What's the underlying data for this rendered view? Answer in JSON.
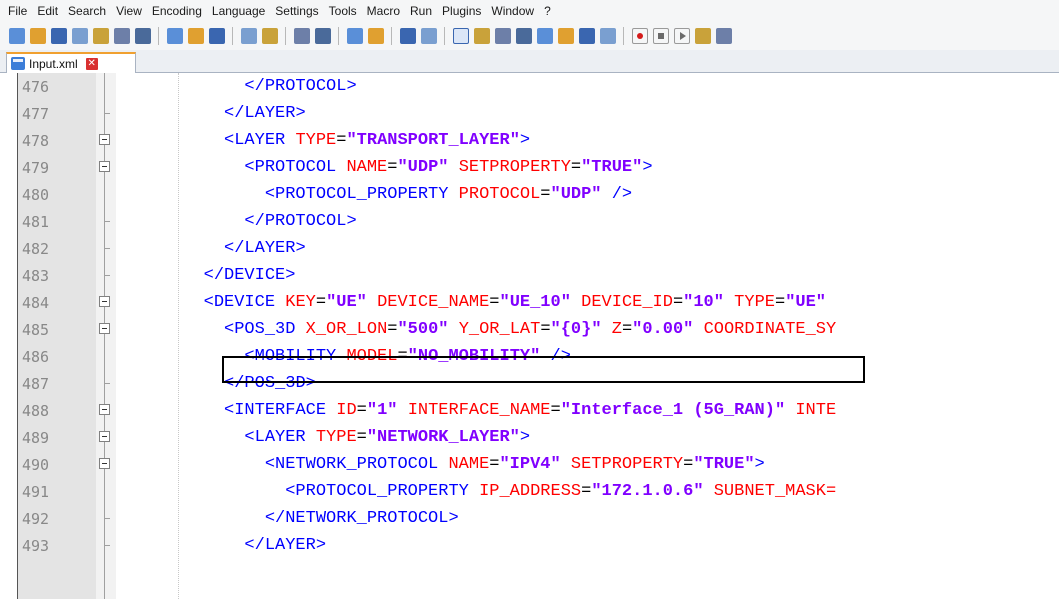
{
  "menu": [
    "File",
    "Edit",
    "Search",
    "View",
    "Encoding",
    "Language",
    "Settings",
    "Tools",
    "Macro",
    "Run",
    "Plugins",
    "Window",
    "?"
  ],
  "tab": {
    "label": "Input.xml",
    "close": "✕"
  },
  "toolbar_icons": [
    "new-file-icon",
    "open-file-icon",
    "save-icon",
    "save-all-icon",
    "close-icon",
    "close-all-icon",
    "print-icon",
    "|",
    "cut-icon",
    "copy-icon",
    "paste-icon",
    "|",
    "undo-icon",
    "redo-icon",
    "|",
    "find-icon",
    "replace-icon",
    "|",
    "zoom-in-icon",
    "zoom-out-icon",
    "|",
    "sync-vertical-icon",
    "sync-horizontal-icon",
    "|",
    "word-wrap-icon",
    "show-all-chars-icon",
    "indent-guide-icon",
    "user-lang-icon",
    "doc-map-icon",
    "function-list-icon",
    "folder-workspace-icon",
    "monitoring-icon",
    "|",
    "record-macro-icon",
    "stop-macro-icon",
    "play-macro-icon",
    "run-macro-multiple-icon",
    "save-macro-icon"
  ],
  "lines": [
    {
      "n": "476",
      "fold": "line",
      "indent": "      ",
      "tokens": [
        [
          "tag",
          "</PROTOCOL>"
        ]
      ]
    },
    {
      "n": "477",
      "fold": "end",
      "indent": "    ",
      "tokens": [
        [
          "tag",
          "</LAYER>"
        ]
      ]
    },
    {
      "n": "478",
      "fold": "box",
      "indent": "    ",
      "tokens": [
        [
          "tag",
          "<LAYER"
        ],
        [
          "plain",
          " "
        ],
        [
          "attr",
          "TYPE"
        ],
        [
          "plain",
          "="
        ],
        [
          "val",
          "\"TRANSPORT_LAYER\""
        ],
        [
          "tag",
          ">"
        ]
      ]
    },
    {
      "n": "479",
      "fold": "box",
      "indent": "      ",
      "tokens": [
        [
          "tag",
          "<PROTOCOL"
        ],
        [
          "plain",
          " "
        ],
        [
          "attr",
          "NAME"
        ],
        [
          "plain",
          "="
        ],
        [
          "val",
          "\"UDP\""
        ],
        [
          "plain",
          " "
        ],
        [
          "attr",
          "SETPROPERTY"
        ],
        [
          "plain",
          "="
        ],
        [
          "val",
          "\"TRUE\""
        ],
        [
          "tag",
          ">"
        ]
      ]
    },
    {
      "n": "480",
      "fold": "line",
      "indent": "        ",
      "tokens": [
        [
          "tag",
          "<PROTOCOL_PROPERTY"
        ],
        [
          "plain",
          " "
        ],
        [
          "attr",
          "PROTOCOL"
        ],
        [
          "plain",
          "="
        ],
        [
          "val",
          "\"UDP\""
        ],
        [
          "plain",
          " "
        ],
        [
          "tag",
          "/>"
        ]
      ]
    },
    {
      "n": "481",
      "fold": "end",
      "indent": "      ",
      "tokens": [
        [
          "tag",
          "</PROTOCOL>"
        ]
      ]
    },
    {
      "n": "482",
      "fold": "end",
      "indent": "    ",
      "tokens": [
        [
          "tag",
          "</LAYER>"
        ]
      ]
    },
    {
      "n": "483",
      "fold": "end",
      "indent": "  ",
      "tokens": [
        [
          "tag",
          "</DEVICE>"
        ]
      ]
    },
    {
      "n": "484",
      "fold": "box",
      "indent": "  ",
      "tokens": [
        [
          "tag",
          "<DEVICE"
        ],
        [
          "plain",
          " "
        ],
        [
          "attr",
          "KEY"
        ],
        [
          "plain",
          "="
        ],
        [
          "val",
          "\"UE\""
        ],
        [
          "plain",
          " "
        ],
        [
          "attr",
          "DEVICE_NAME"
        ],
        [
          "plain",
          "="
        ],
        [
          "val",
          "\"UE_10\""
        ],
        [
          "plain",
          " "
        ],
        [
          "attr",
          "DEVICE_ID"
        ],
        [
          "plain",
          "="
        ],
        [
          "val",
          "\"10\""
        ],
        [
          "plain",
          " "
        ],
        [
          "attr",
          "TYPE"
        ],
        [
          "plain",
          "="
        ],
        [
          "val",
          "\"UE\""
        ]
      ]
    },
    {
      "n": "485",
      "fold": "box",
      "indent": "    ",
      "tokens": [
        [
          "tag",
          "<POS_3D"
        ],
        [
          "plain",
          " "
        ],
        [
          "attr",
          "X_OR_LON"
        ],
        [
          "plain",
          "="
        ],
        [
          "val",
          "\"500\""
        ],
        [
          "plain",
          " "
        ],
        [
          "attr",
          "Y_OR_LAT"
        ],
        [
          "plain",
          "="
        ],
        [
          "val",
          "\"{0}\""
        ],
        [
          "plain",
          " "
        ],
        [
          "attr",
          "Z"
        ],
        [
          "plain",
          "="
        ],
        [
          "val",
          "\"0.00\""
        ],
        [
          "plain",
          " "
        ],
        [
          "attr",
          "COORDINATE_SY"
        ]
      ]
    },
    {
      "n": "486",
      "fold": "line",
      "indent": "      ",
      "tokens": [
        [
          "tag",
          "<MOBILITY"
        ],
        [
          "plain",
          " "
        ],
        [
          "attr",
          "MODEL"
        ],
        [
          "plain",
          "="
        ],
        [
          "val",
          "\"NO_MOBILITY\""
        ],
        [
          "plain",
          " "
        ],
        [
          "tag",
          "/>"
        ]
      ]
    },
    {
      "n": "487",
      "fold": "end",
      "indent": "    ",
      "tokens": [
        [
          "tag",
          "</POS_3D>"
        ]
      ]
    },
    {
      "n": "488",
      "fold": "box",
      "indent": "    ",
      "tokens": [
        [
          "tag",
          "<INTERFACE"
        ],
        [
          "plain",
          " "
        ],
        [
          "attr",
          "ID"
        ],
        [
          "plain",
          "="
        ],
        [
          "val",
          "\"1\""
        ],
        [
          "plain",
          " "
        ],
        [
          "attr",
          "INTERFACE_NAME"
        ],
        [
          "plain",
          "="
        ],
        [
          "val",
          "\"Interface_1 (5G_RAN)\""
        ],
        [
          "plain",
          " "
        ],
        [
          "attr",
          "INTE"
        ]
      ]
    },
    {
      "n": "489",
      "fold": "box",
      "indent": "      ",
      "tokens": [
        [
          "tag",
          "<LAYER"
        ],
        [
          "plain",
          " "
        ],
        [
          "attr",
          "TYPE"
        ],
        [
          "plain",
          "="
        ],
        [
          "val",
          "\"NETWORK_LAYER\""
        ],
        [
          "tag",
          ">"
        ]
      ]
    },
    {
      "n": "490",
      "fold": "box",
      "indent": "        ",
      "tokens": [
        [
          "tag",
          "<NETWORK_PROTOCOL"
        ],
        [
          "plain",
          " "
        ],
        [
          "attr",
          "NAME"
        ],
        [
          "plain",
          "="
        ],
        [
          "val",
          "\"IPV4\""
        ],
        [
          "plain",
          " "
        ],
        [
          "attr",
          "SETPROPERTY"
        ],
        [
          "plain",
          "="
        ],
        [
          "val",
          "\"TRUE\""
        ],
        [
          "tag",
          ">"
        ]
      ]
    },
    {
      "n": "491",
      "fold": "line",
      "indent": "          ",
      "tokens": [
        [
          "tag",
          "<PROTOCOL_PROPERTY"
        ],
        [
          "plain",
          " "
        ],
        [
          "attr",
          "IP_ADDRESS"
        ],
        [
          "plain",
          "="
        ],
        [
          "val",
          "\"172.1.0.6\""
        ],
        [
          "plain",
          " "
        ],
        [
          "attr",
          "SUBNET_MASK="
        ]
      ]
    },
    {
      "n": "492",
      "fold": "end",
      "indent": "        ",
      "tokens": [
        [
          "tag",
          "</NETWORK_PROTOCOL>"
        ]
      ]
    },
    {
      "n": "493",
      "fold": "end",
      "indent": "      ",
      "tokens": [
        [
          "tag",
          "</LAYER>"
        ]
      ]
    }
  ]
}
